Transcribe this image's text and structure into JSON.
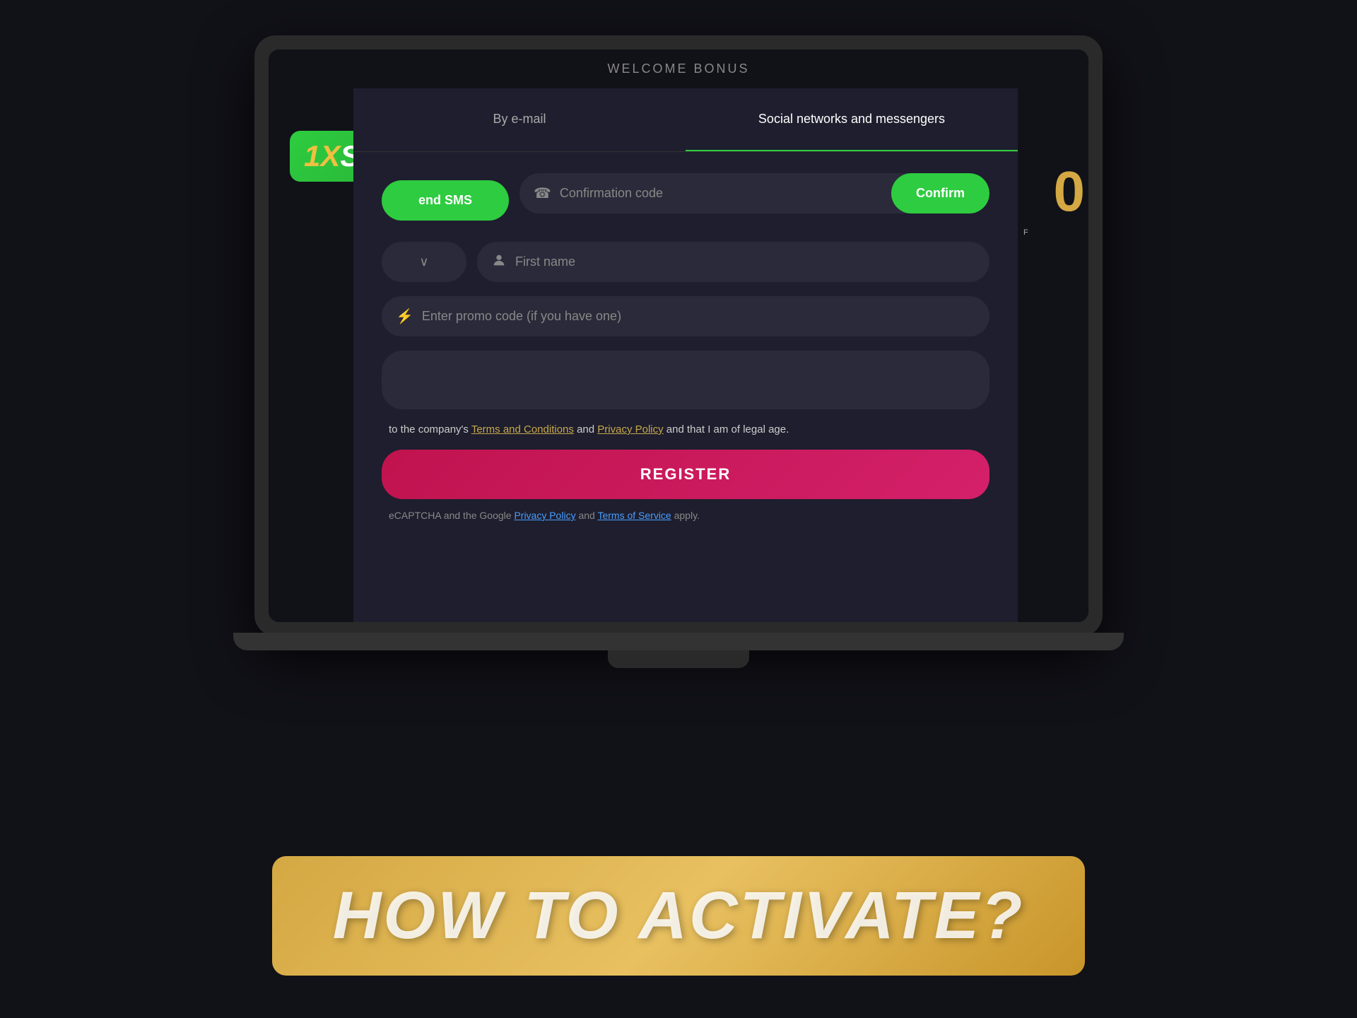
{
  "logo": {
    "text_1x": "1X",
    "text_slots": "SLOTS"
  },
  "welcome_bar": {
    "text": "WELCOME BONUS"
  },
  "tabs": [
    {
      "id": "email",
      "label": "By e-mail",
      "active": false
    },
    {
      "id": "social",
      "label": "Social networks and messengers",
      "active": true
    }
  ],
  "form": {
    "send_sms_label": "end SMS",
    "confirmation_code_placeholder": "Confirmation code",
    "confirm_button_label": "Confirm",
    "chevron_icon": "∨",
    "first_name_placeholder": "First name",
    "promo_placeholder": "Enter promo code (if you have one)",
    "terms_text_prefix": "to the company's ",
    "terms_link1": "Terms and Conditions",
    "terms_text_middle": " and ",
    "terms_link2": "Privacy Policy",
    "terms_text_suffix": " and that I am of legal age.",
    "register_label": "REGISTER",
    "captcha_text_prefix": "eCAPTCHA and the Google ",
    "captcha_link1": "Privacy Policy",
    "captcha_text_middle": " and ",
    "captcha_link2": "Terms of Service",
    "captcha_text_suffix": " apply."
  },
  "banner": {
    "text": "HOW TO ACTIVATE?"
  },
  "icons": {
    "phone": "📞",
    "person": "👤",
    "lightning": "⚡"
  }
}
